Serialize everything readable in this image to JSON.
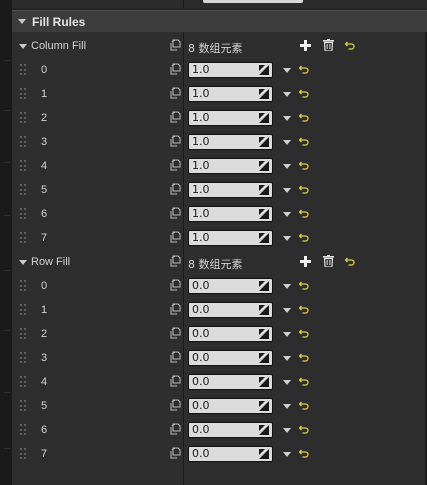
{
  "category": {
    "title": "Fill Rules"
  },
  "arrays": [
    {
      "name": "Column Fill",
      "count_label": "8 数组元素",
      "elements": [
        {
          "index": "0",
          "value": "1.0"
        },
        {
          "index": "1",
          "value": "1.0"
        },
        {
          "index": "2",
          "value": "1.0"
        },
        {
          "index": "3",
          "value": "1.0"
        },
        {
          "index": "4",
          "value": "1.0"
        },
        {
          "index": "5",
          "value": "1.0"
        },
        {
          "index": "6",
          "value": "1.0"
        },
        {
          "index": "7",
          "value": "1.0"
        }
      ]
    },
    {
      "name": "Row Fill",
      "count_label": "8 数组元素",
      "elements": [
        {
          "index": "0",
          "value": "0.0"
        },
        {
          "index": "1",
          "value": "0.0"
        },
        {
          "index": "2",
          "value": "0.0"
        },
        {
          "index": "3",
          "value": "0.0"
        },
        {
          "index": "4",
          "value": "0.0"
        },
        {
          "index": "5",
          "value": "0.0"
        },
        {
          "index": "6",
          "value": "0.0"
        },
        {
          "index": "7",
          "value": "0.0"
        }
      ]
    }
  ],
  "icons": {
    "add": "plus-icon",
    "delete": "trash-icon",
    "reset": "reset-to-default-icon",
    "copy": "copy-paste-icon",
    "spin": "numeric-spin-icon",
    "handle": "drag-handle-icon"
  },
  "colors": {
    "background": "#242424",
    "panel": "#2d2d2d",
    "category_header": "#3c3c3c",
    "field": "#dcdcdc",
    "reset_accent": "#d8d43a"
  }
}
